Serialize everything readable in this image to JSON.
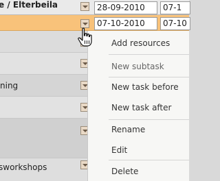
{
  "header_row": {
    "task_name": "e / Elterbeila",
    "start_date": "28-09-2010",
    "end_date": "07-1"
  },
  "selected_row": {
    "start_date": "07-10-2010",
    "end_date": "07-10"
  },
  "rows": [
    {
      "name": "",
      "bold": false
    },
    {
      "name": "",
      "bold": false
    },
    {
      "name": "ning",
      "bold": true
    },
    {
      "name": "",
      "bold": false
    },
    {
      "name": "",
      "bold": false
    },
    {
      "name": "sworkshops",
      "bold": false
    }
  ],
  "context_menu": {
    "items": [
      {
        "label": "Add resources",
        "enabled": true
      },
      {
        "label": "New subtask",
        "enabled": false
      },
      {
        "label": "New task before",
        "enabled": true
      },
      {
        "label": "New task after",
        "enabled": true
      },
      {
        "label": "Rename",
        "enabled": true
      },
      {
        "label": "Edit",
        "enabled": true
      },
      {
        "label": "Delete",
        "enabled": true
      }
    ]
  },
  "colors": {
    "selected_row_bg": "#f8c27a",
    "menu_bg": "#f7f7f5",
    "grid_bg": "#d9d9d9"
  },
  "cursor": "hand-pointer-icon"
}
